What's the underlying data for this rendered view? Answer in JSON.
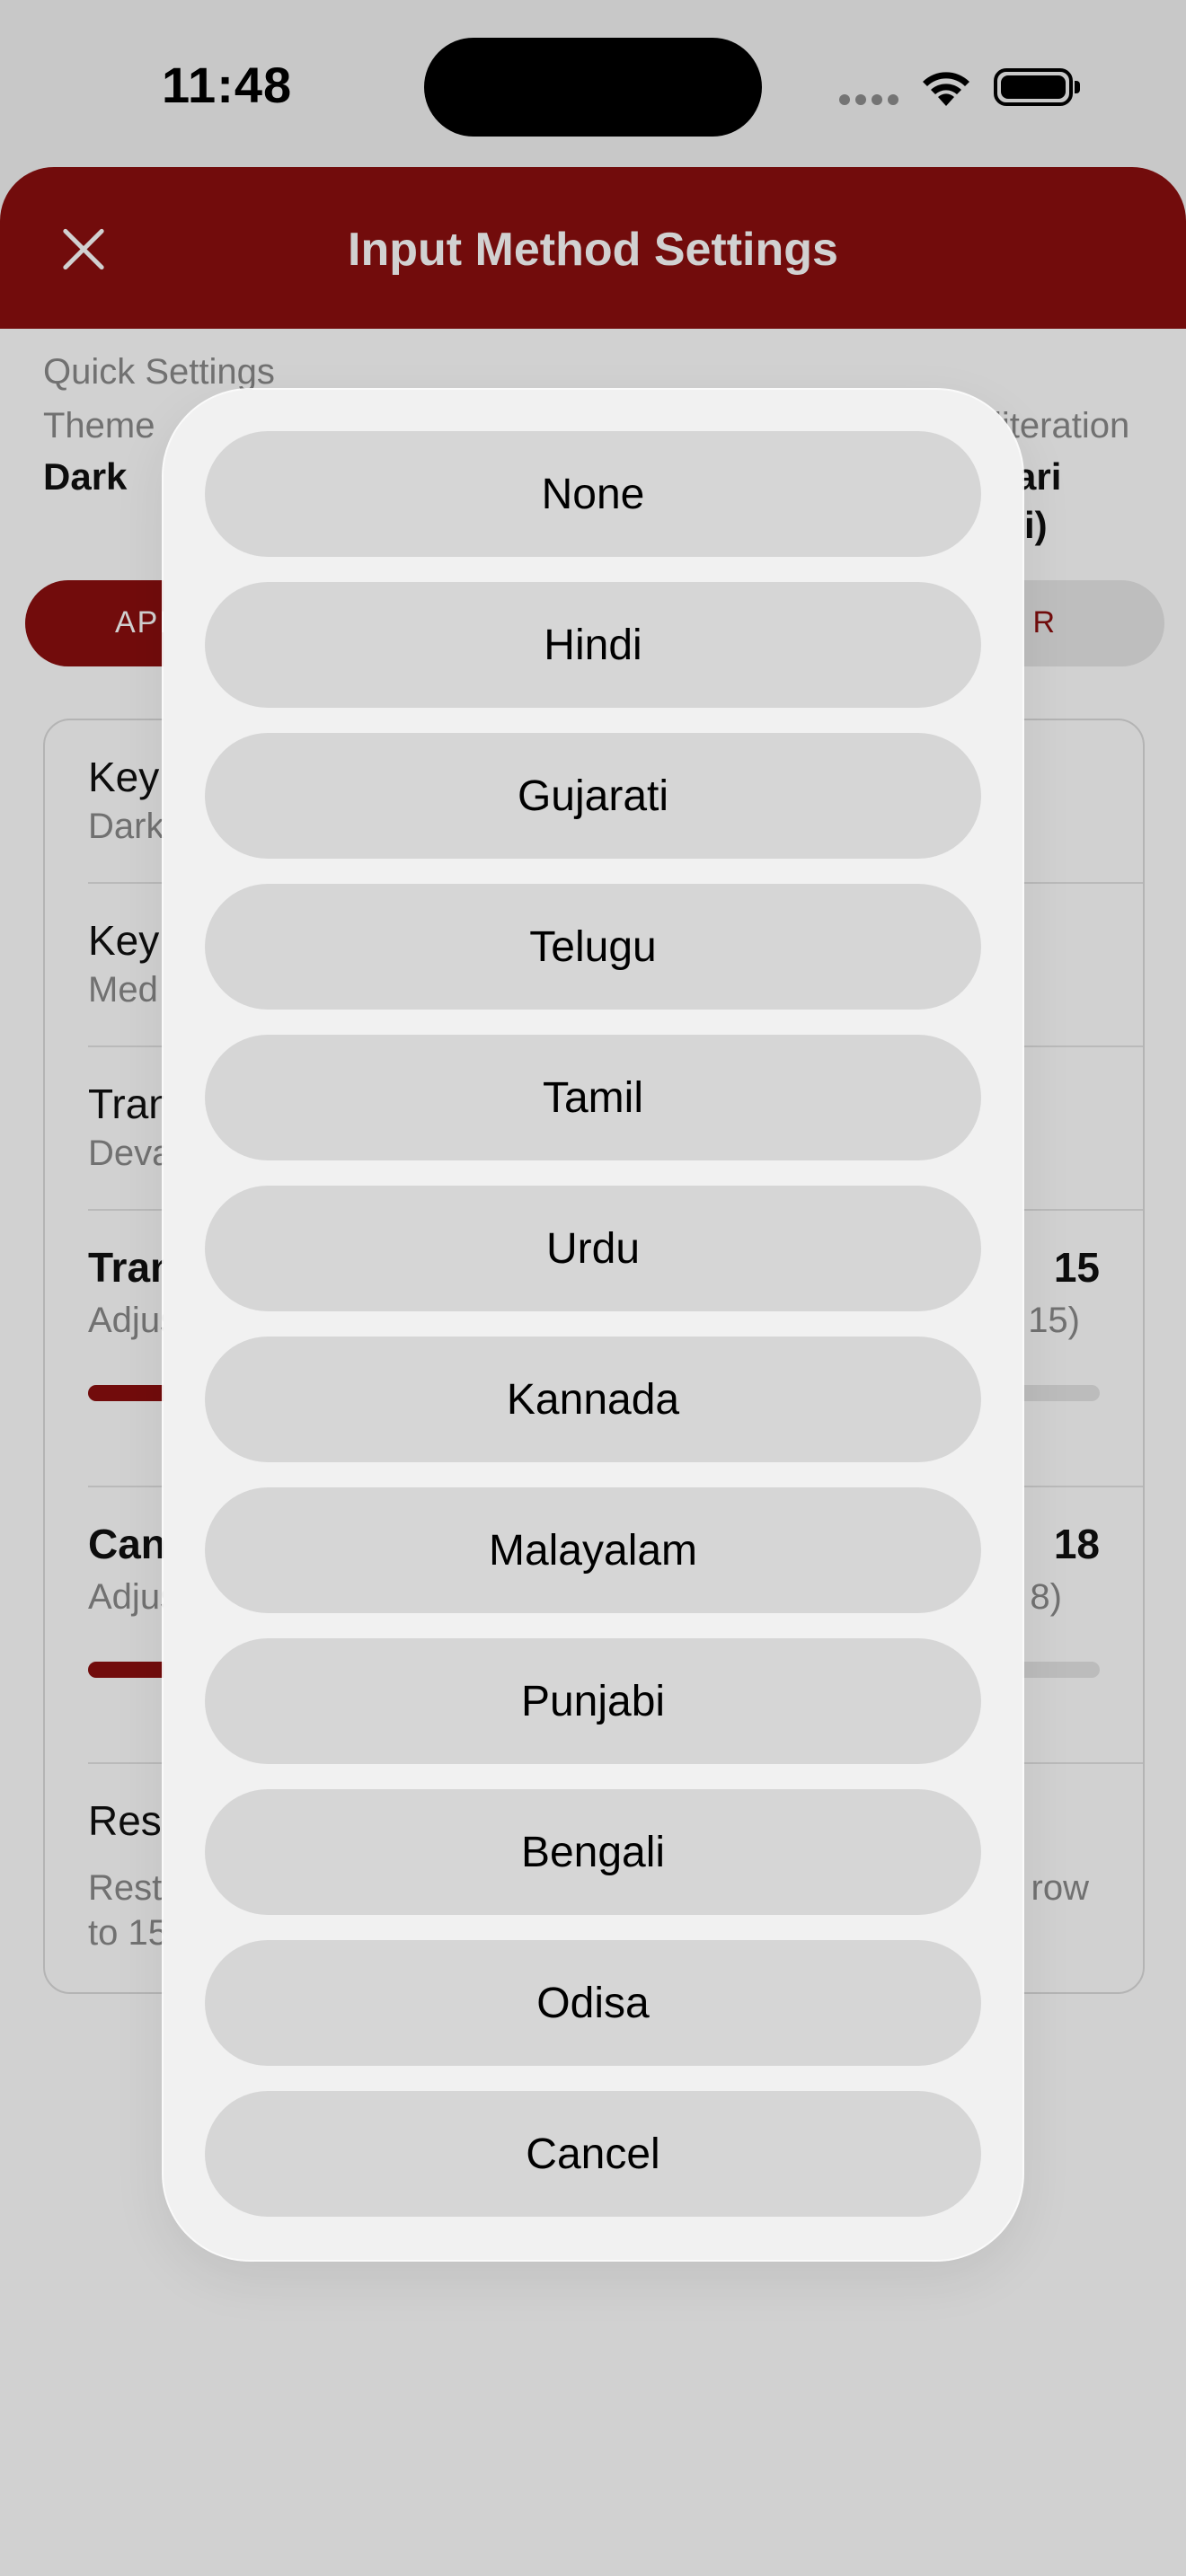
{
  "status_bar": {
    "time": "11:48"
  },
  "header": {
    "title": "Input Method Settings"
  },
  "quick_settings": {
    "label": "Quick Settings",
    "theme_label": "Theme",
    "theme_value": "Dark",
    "transliteration_label": "literation",
    "transliteration_value_line1": "ari",
    "transliteration_value_line2": "i)"
  },
  "tabs": {
    "left_label": "APP",
    "right_label": "R"
  },
  "settings_rows": [
    {
      "title": "Key",
      "subtitle": "Dark"
    },
    {
      "title": "Key",
      "subtitle": "Med"
    },
    {
      "title": "Tran",
      "subtitle": "Deva"
    }
  ],
  "slider_rows": [
    {
      "title": "Tran",
      "value": "15",
      "subtitle_left": "Adjus",
      "subtitle_right": "15)",
      "fill_percent": 28
    },
    {
      "title": "Can",
      "value": "18",
      "subtitle_left": "Adjus",
      "subtitle_right": "8)",
      "fill_percent": 52
    }
  ],
  "reset_row": {
    "title": "Res",
    "subtitle_line1_left": "Reste",
    "subtitle_line1_right": "row",
    "subtitle_line2_left": "to 15"
  },
  "action_sheet": {
    "options": [
      "None",
      "Hindi",
      "Gujarati",
      "Telugu",
      "Tamil",
      "Urdu",
      "Kannada",
      "Malayalam",
      "Punjabi",
      "Bengali",
      "Odisa"
    ],
    "cancel_label": "Cancel"
  },
  "colors": {
    "brand": "#8b0f0f",
    "sheet_bg": "#f1f1f1",
    "option_bg": "#d6d6d6"
  }
}
